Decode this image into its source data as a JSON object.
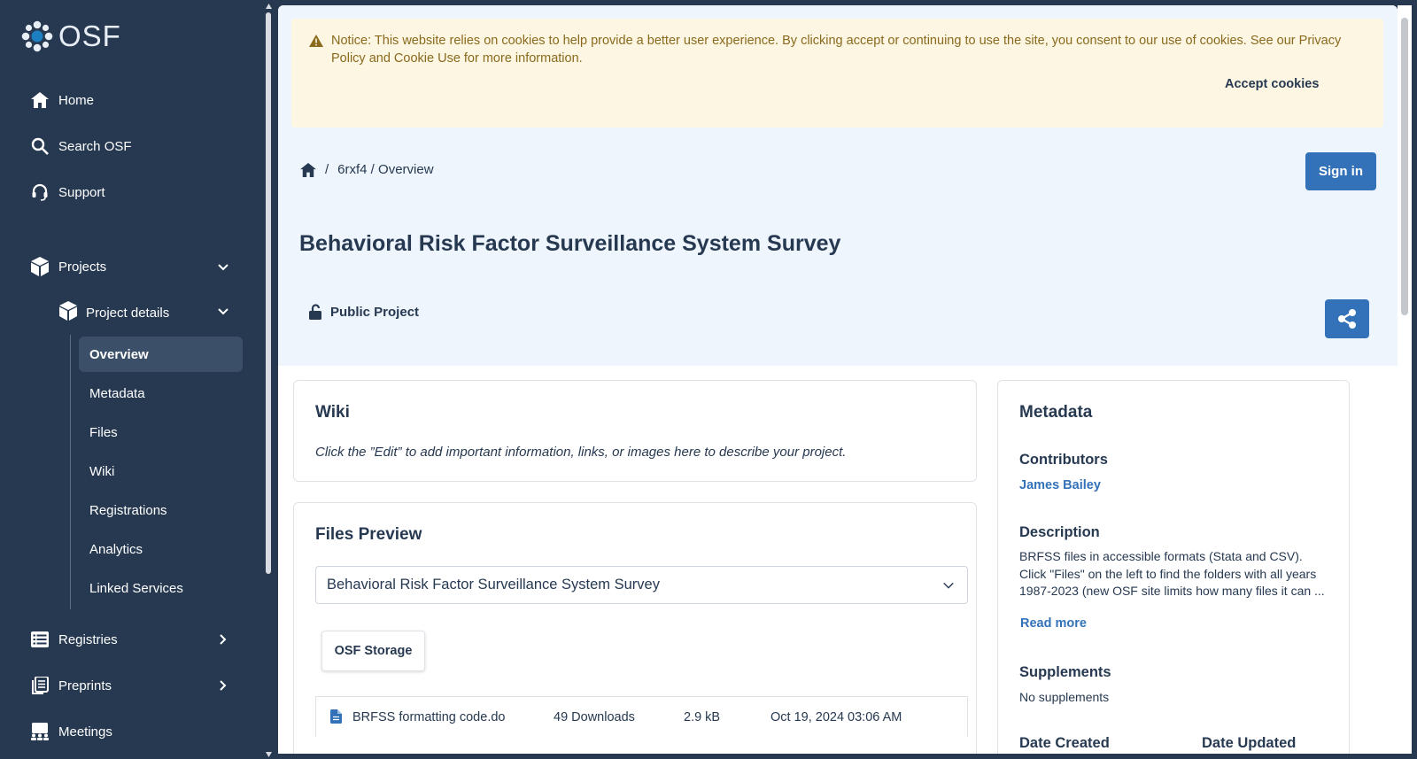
{
  "sidebar": {
    "logo_text": "OSF",
    "nav": [
      {
        "label": "Home",
        "icon": "home-icon"
      },
      {
        "label": "Search OSF",
        "icon": "search-icon"
      },
      {
        "label": "Support",
        "icon": "headset-icon"
      },
      {
        "label": "Projects",
        "icon": "cube-icon"
      },
      {
        "label": "Registries",
        "icon": "registries-icon"
      },
      {
        "label": "Preprints",
        "icon": "preprints-icon"
      },
      {
        "label": "Meetings",
        "icon": "meetings-icon"
      }
    ],
    "project_details_label": "Project details",
    "subnav": [
      "Overview",
      "Metadata",
      "Files",
      "Wiki",
      "Registrations",
      "Analytics",
      "Linked Services"
    ]
  },
  "cookie": {
    "text": "Notice: This website relies on cookies to help provide a better user experience. By clicking accept or continuing to use the site, you consent to our use of cookies. See our Privacy Policy and Cookie Use for more information.",
    "accept_label": "Accept cookies"
  },
  "breadcrumb": {
    "separator": "/",
    "path": "6rxf4 / Overview"
  },
  "signin_label": "Sign in",
  "project": {
    "title": "Behavioral Risk Factor Surveillance System Survey",
    "visibility": "Public Project"
  },
  "wiki": {
    "title": "Wiki",
    "text": "Click the ”Edit” to add important information, links, or images here to describe your project."
  },
  "files_preview": {
    "title": "Files Preview",
    "selected": "Behavioral Risk Factor Surveillance System Survey",
    "storage_label": "OSF Storage",
    "files": [
      {
        "name": "BRFSS formatting code.do",
        "downloads": "49 Downloads",
        "size": "2.9 kB",
        "date": "Oct 19, 2024 03:06 AM"
      }
    ]
  },
  "metadata": {
    "title": "Metadata",
    "contributors_heading": "Contributors",
    "contributor": "James Bailey",
    "description_heading": "Description",
    "description": "BRFSS files in accessible formats (Stata and CSV). Click \"Files\" on the left to find the folders with all years 1987-2023 (new OSF site limits how many files it can ...",
    "read_more": "Read more",
    "supplements_heading": "Supplements",
    "supplements_value": "No supplements",
    "date_created_heading": "Date Created",
    "date_updated_heading": "Date Updated"
  },
  "colors": {
    "sidebar": "#263951",
    "primary": "#3372b9",
    "hero": "#eef5fc",
    "notice": "#fdf6e3"
  }
}
